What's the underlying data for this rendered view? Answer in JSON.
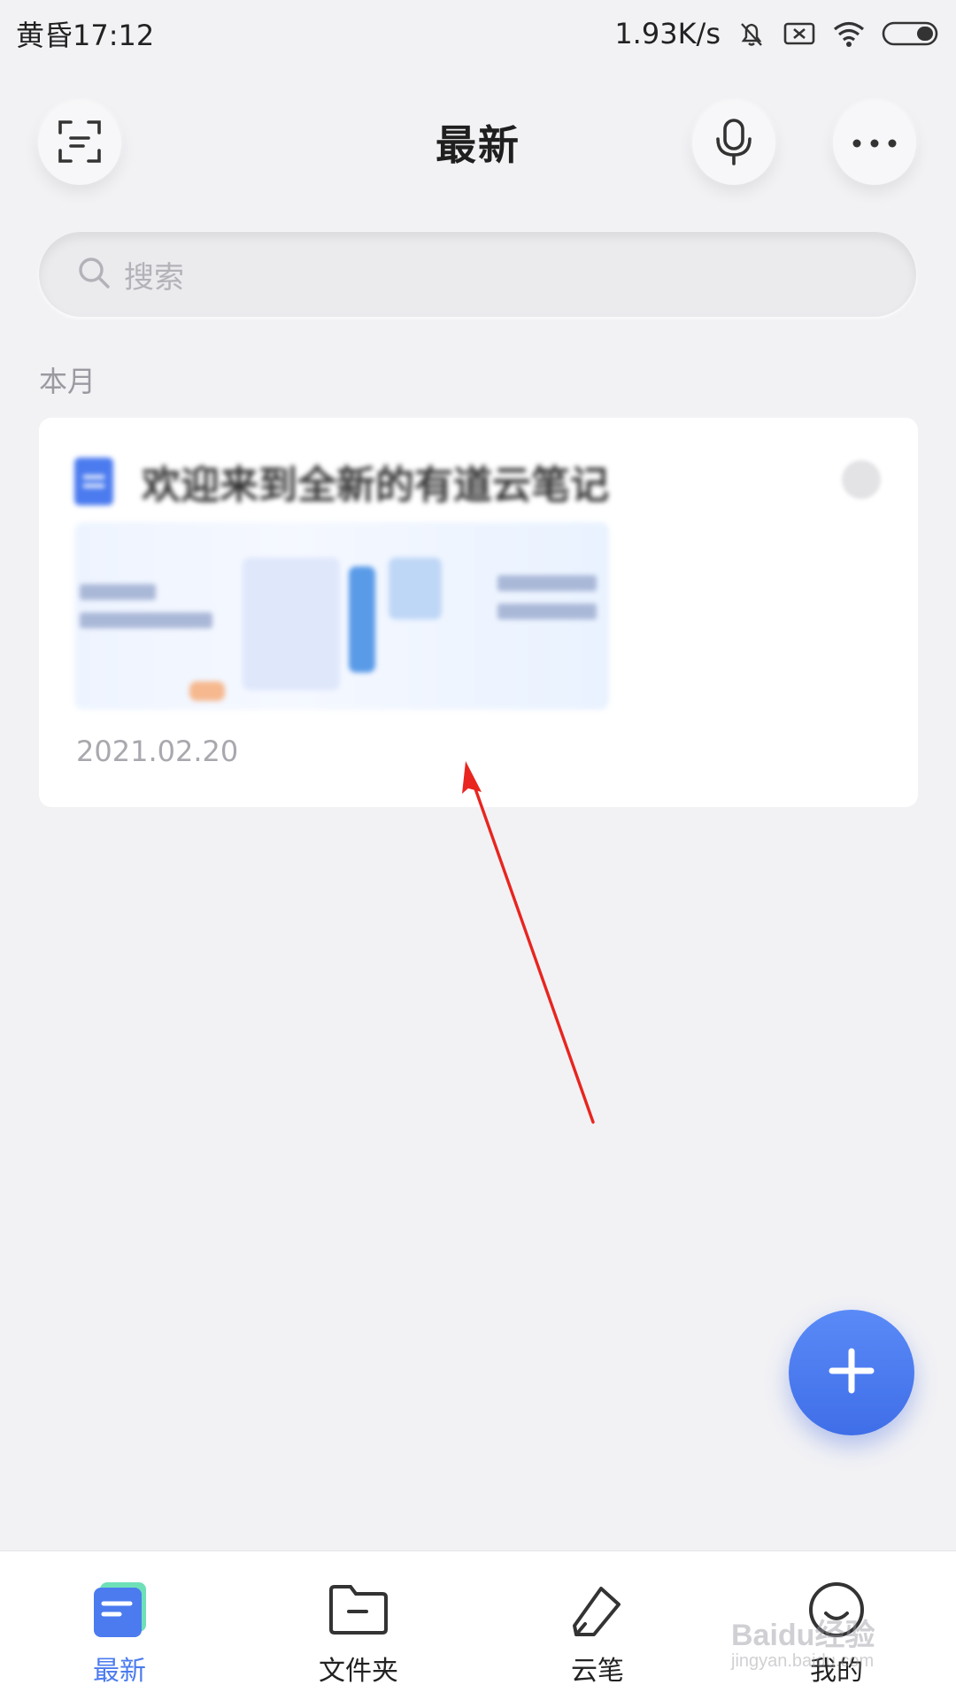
{
  "status_bar": {
    "time": "黄昏17:12",
    "net_speed": "1.93K/s"
  },
  "header": {
    "title": "最新"
  },
  "search": {
    "placeholder": "搜索"
  },
  "section": {
    "label": "本月"
  },
  "note_card": {
    "title": "欢迎来到全新的有道云笔记",
    "date": "2021.02.20"
  },
  "bottom_nav": {
    "items": [
      {
        "label": "最新",
        "icon": "notes-icon",
        "active": true
      },
      {
        "label": "文件夹",
        "icon": "folder-icon",
        "active": false
      },
      {
        "label": "云笔",
        "icon": "pen-icon",
        "active": false
      },
      {
        "label": "我的",
        "icon": "profile-icon",
        "active": false
      }
    ]
  },
  "watermark": {
    "brand": "Baidu经验",
    "url": "jingyan.baidu.com"
  },
  "colors": {
    "accent": "#4b7bef",
    "annotation": "#e8251f",
    "background": "#f2f2f5"
  }
}
